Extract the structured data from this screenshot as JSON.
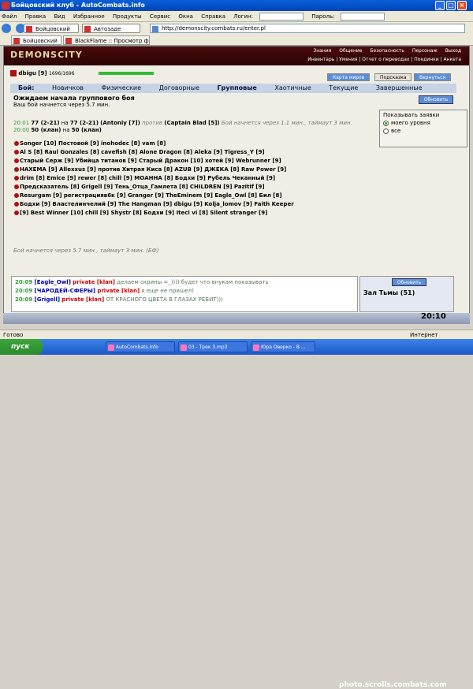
{
  "window": {
    "title": "Бойцовский клуб - AutoCombats.info"
  },
  "menu": {
    "items": [
      "Файл",
      "Правка",
      "Вид",
      "Избранное",
      "Продукты",
      "Сервис",
      "Окна",
      "Справка"
    ],
    "login_label": "Логин:",
    "password_label": "Пароль:"
  },
  "toolbar": {
    "tab1": "Бойцовский клуб",
    "autofill": "Автозаде",
    "address": "http://demonscity.combats.ru/enter.pl"
  },
  "tabs2": {
    "tab1": "Бойцовский клуб",
    "tab2": "BlackFlame :: Просмотр форума..."
  },
  "site": {
    "logo": "DEMONSCITY",
    "topmenu": [
      "Знания",
      "Общение",
      "Безопасность",
      "Персонаж",
      "Выход"
    ],
    "submenu": "Инвентарь | Умения | Отчет о переводах | Поединки | Анкета",
    "user": " dbigu [9]",
    "hp": "1696/1696",
    "hp_fraction": 1.0,
    "buttons": {
      "map": "Карта миров",
      "hint": "Подсказка",
      "back": "Вернуться"
    }
  },
  "tabs": {
    "label": "Бой:",
    "items": [
      "Новичков",
      "Физические",
      "Договорные",
      "Групповые",
      "Хаотичные",
      "Текущие",
      "Завершенные"
    ]
  },
  "status": {
    "waiting": "Ожидаем начала группового боя",
    "start": "Ваш бой начнется через 5.7 мин.",
    "refresh": "Обновить"
  },
  "show_box": {
    "title": "Показывать заявки",
    "options": [
      "моего уровня",
      "все"
    ],
    "selected": 0
  },
  "battles": [
    {
      "time": "20:01",
      "text_a": "77 (2-21)",
      "mid": " на ",
      "text_b": "77 (2-21)",
      "p1": "(Antoniy [7])",
      "against": " против ",
      "p2": "(Captain Blad [5])",
      "note": "Бой начнется через 1.1 мин., таймаут 3 мин."
    },
    {
      "time": "20:00",
      "text_a": "50 (клан)",
      "mid": " на ",
      "text_b": "50 (клан)"
    }
  ],
  "teams_text": [
    "Songer [10]  Постовой [9]  inohodec [8]  vam [8]",
    "Al S [8]  Raul Gonzales [8]  cavefish [8]  Alone Dragon [8]  Aleka [9]  Tigress_Y [9]",
    "Старый Серж [9]  Убийца титанов [9]  Старый Дракон [10]  хотей [9]  Webrunner [9]",
    "НАХЕМА [9]  Allexxus [9]  против  Хитрая Киса [8]  AZUB [9]  ДЖЕКА [8]  Raw Power [9]",
    "drim [8]  Emice [9]  rewer [8]  chill [9]  МОАННА [8]  Бодхи [9]  Рубель Чеканный [9]",
    "Предсказатель [8]  Grigell [9]  Тень_Отца_Гамлета [8]  CHILDREN [9]  Pazitif [9]",
    "Resurgam [9]  регистрацияв6к [9]  Granger [9]  TheEminem [9]  Eagle_Owl [8]  Бил [8]",
    "Бодхи [9]  Властелинчелий [9]  The Hangman [9]  dbigu [9]  Kolja_lomov [9]  Faith Keeper",
    "[9]  Best Winner [10]  chill [9]  Shystr [8]  Бодхи [9]  Iteci vi [8]  Silent stranger [9]"
  ],
  "footer_note": "Бой начнется через 5.7 мин., таймаут 3 мин. (БФ)",
  "chat": [
    {
      "time": "20:09",
      "nick": "[Eagle_Owl]",
      "pvt": "private [klan]",
      "msg": "делаем скрины =_)))) будет что внукам показывать"
    },
    {
      "time": "20:09",
      "nick": "[ЧАРОДЕЙ-СФЕРЫ]",
      "pvt": "private [klan]",
      "msg": "я еще не пришел)"
    },
    {
      "time": "20:09",
      "nick": "[Grigell]",
      "pvt": "private [klan]",
      "msg": "ОТ КРАСНОГО ЦВЕТА В ГЛАЗАХ РЕБИТ)))"
    }
  ],
  "right_panel": {
    "refresh": "Обновить",
    "room": "Зал Тьмы (51)"
  },
  "clock": "20:10",
  "statusbar": {
    "left": "Готово",
    "right": "Интернет"
  },
  "taskbar": {
    "start": "пуск",
    "tasks": [
      "AutoCombats.info",
      "03 - Трек 3.mp3",
      "Юра Оверко - В ..."
    ],
    "watermark": "photo.scrolls.combats.com"
  }
}
